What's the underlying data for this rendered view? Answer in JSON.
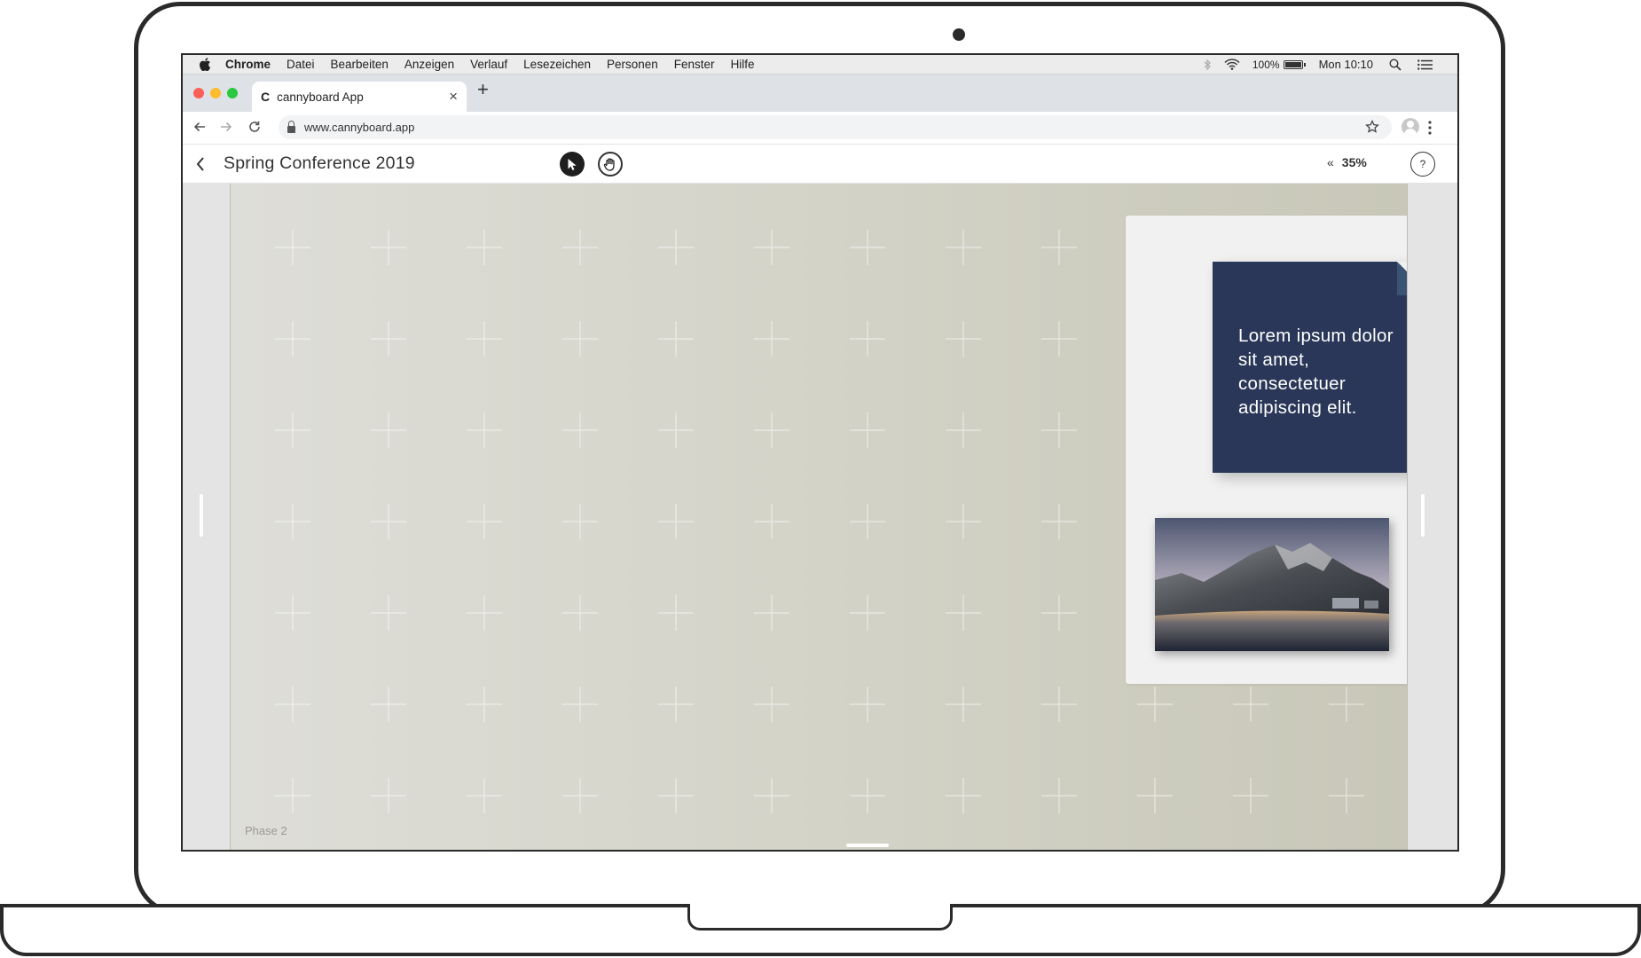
{
  "menubar": {
    "app_name": "Chrome",
    "items": [
      "Datei",
      "Bearbeiten",
      "Anzeigen",
      "Verlauf",
      "Lesezeichen",
      "Personen",
      "Fenster",
      "Hilfe"
    ],
    "battery": "100%",
    "clock": "Mon 10:10"
  },
  "browser": {
    "tab_title": "cannyboard App",
    "tab_favicon": "C",
    "url": "www.cannyboard.app"
  },
  "app": {
    "back_label": "‹",
    "title": "Spring Conference 2019",
    "zoom": "35%",
    "zoom_toggle": "«",
    "help": "?"
  },
  "board": {
    "phase_label": "Phase 2",
    "note_text": "Lorem ipsum dolor sit amet, consectetuer adipiscing elit.",
    "note_color": "#2a3758",
    "fab_label": "+",
    "fab_color": "#ec4a52"
  },
  "icons": {
    "apple": "apple-icon",
    "bluetooth": "bluetooth-icon",
    "wifi": "wifi-icon",
    "battery": "battery-icon",
    "spotlight": "search-icon",
    "notification_center": "list-icon",
    "select_tool": "cursor-icon",
    "pan_tool": "hand-icon",
    "bookmark": "star-icon",
    "profile": "avatar-icon",
    "menu": "kebab-menu-icon"
  }
}
